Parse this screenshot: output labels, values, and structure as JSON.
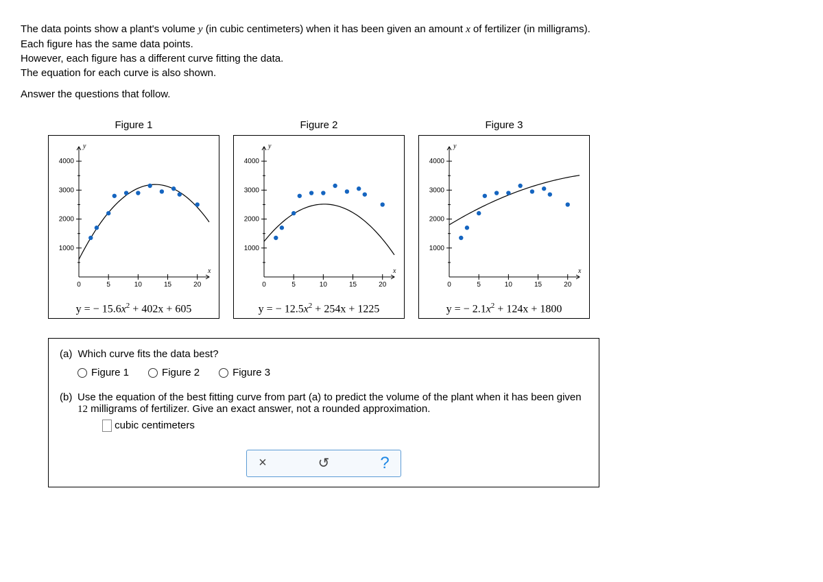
{
  "intro": {
    "line1_a": "The data points show a plant's volume ",
    "line1_var1": "y",
    "line1_b": " (in cubic centimeters) when it has been given an amount ",
    "line1_var2": "x",
    "line1_c": " of fertilizer (in milligrams).",
    "line2": "Each figure has the same data points.",
    "line3": "However, each figure has a different curve fitting the data.",
    "line4": "The equation for each curve is also shown.",
    "line5": "Answer the questions that follow."
  },
  "axis": {
    "ylabel": "y",
    "xlabel": "x",
    "yticks": [
      "1000",
      "2000",
      "3000",
      "4000"
    ],
    "xticks": [
      "0",
      "5",
      "10",
      "15",
      "20"
    ]
  },
  "figures": [
    {
      "title": "Figure 1",
      "eq_prefix": "y = − 15.6",
      "eq_var": "x",
      "eq_sup": "2",
      "eq_suffix": " + 402x + 605"
    },
    {
      "title": "Figure 2",
      "eq_prefix": "y = − 12.5",
      "eq_var": "x",
      "eq_sup": "2",
      "eq_suffix": " + 254x + 1225"
    },
    {
      "title": "Figure 3",
      "eq_prefix": "y = − 2.1",
      "eq_var": "x",
      "eq_sup": "2",
      "eq_suffix": " + 124x + 1800"
    }
  ],
  "chart_data": {
    "type": "scatter",
    "xlabel": "x",
    "ylabel": "y",
    "xlim": [
      0,
      22
    ],
    "ylim": [
      0,
      4500
    ],
    "xticks": [
      0,
      5,
      10,
      15,
      20
    ],
    "yticks": [
      1000,
      2000,
      3000,
      4000
    ],
    "shared_points": [
      {
        "x": 2,
        "y": 1350
      },
      {
        "x": 3,
        "y": 1700
      },
      {
        "x": 5,
        "y": 2200
      },
      {
        "x": 6,
        "y": 2800
      },
      {
        "x": 8,
        "y": 2900
      },
      {
        "x": 10,
        "y": 2900
      },
      {
        "x": 12,
        "y": 3150
      },
      {
        "x": 14,
        "y": 2950
      },
      {
        "x": 16,
        "y": 3050
      },
      {
        "x": 17,
        "y": 2850
      },
      {
        "x": 20,
        "y": 2500
      }
    ],
    "series": [
      {
        "name": "Figure 1",
        "curve": {
          "a": -15.6,
          "b": 402,
          "c": 605
        }
      },
      {
        "name": "Figure 2",
        "curve": {
          "a": -12.5,
          "b": 254,
          "c": 1225
        }
      },
      {
        "name": "Figure 3",
        "curve": {
          "a": -2.1,
          "b": 124,
          "c": 1800
        }
      }
    ]
  },
  "questions": {
    "a_label": "(a)",
    "a_text": "Which curve fits the data best?",
    "a_options": [
      "Figure 1",
      "Figure 2",
      "Figure 3"
    ],
    "b_label": "(b)",
    "b_text_1": "Use the equation of the best fitting curve from part (a) to predict the volume of the plant when it has been given ",
    "b_text_num": "12",
    "b_text_2": " milligrams of fertilizer. Give an exact answer, not a rounded approximation.",
    "b_unit": " cubic centimeters"
  },
  "toolbar": {
    "close": "×",
    "reset": "↺",
    "help": "?"
  }
}
